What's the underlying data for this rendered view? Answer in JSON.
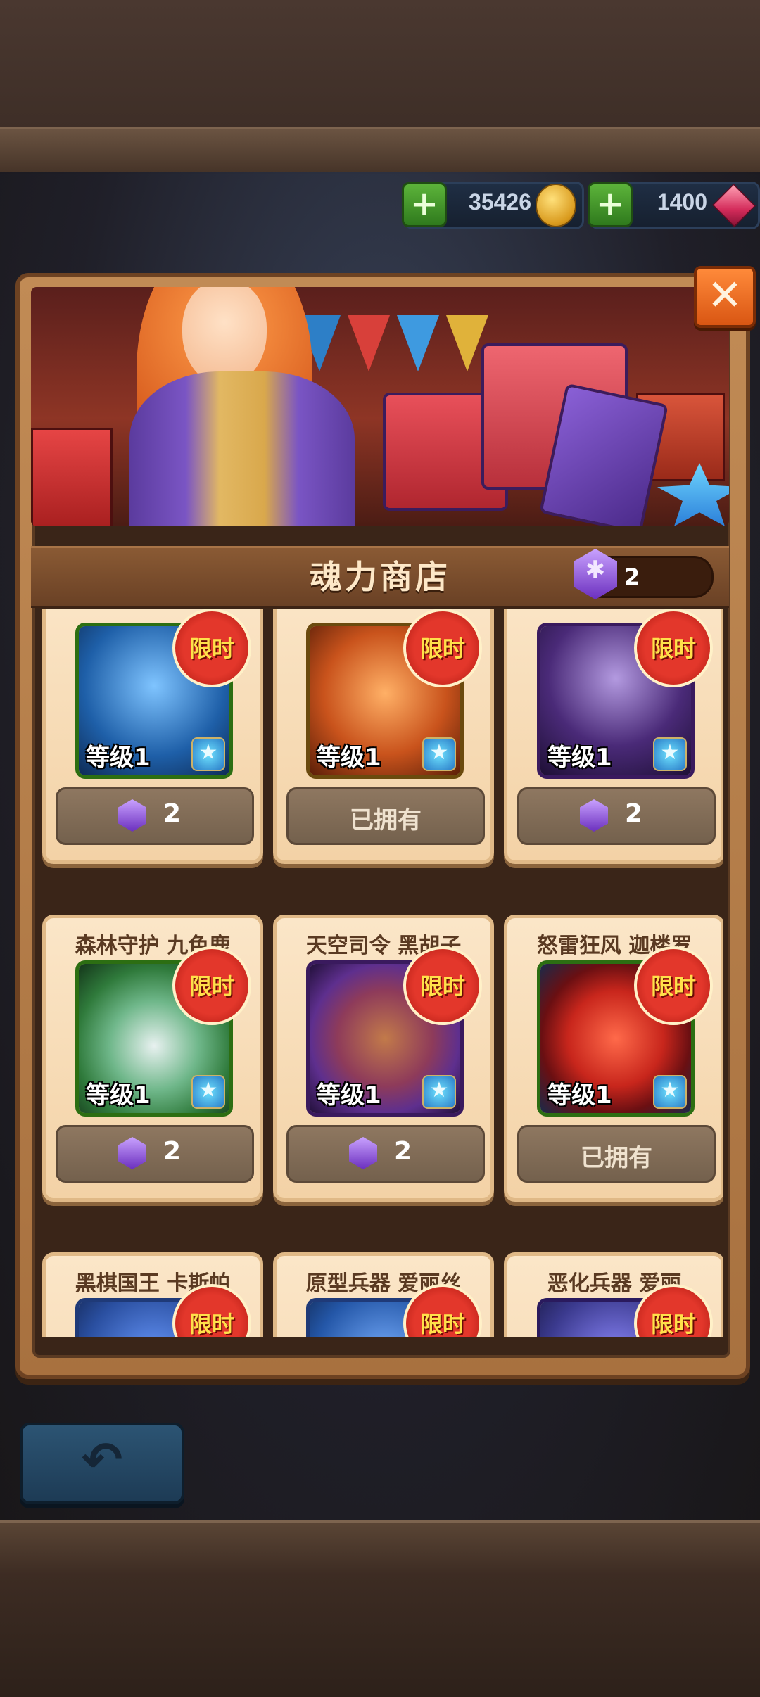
{
  "currencies": [
    {
      "id": "gold",
      "value": "35426",
      "icon": "gold-coin-icon"
    },
    {
      "id": "gems",
      "value": "1400",
      "icon": "red-gem-icon"
    }
  ],
  "shop": {
    "title": "魂力商店",
    "soul_power": "2",
    "close_icon": "close-icon",
    "back_icon": "back-arrow-icon"
  },
  "items": [
    {
      "name": "",
      "level": "等级1",
      "badge": "限时",
      "price": "2",
      "owned": false,
      "color": "#1e5fa8"
    },
    {
      "name": "",
      "level": "等级1",
      "badge": "限时",
      "price": "",
      "owned": true,
      "owned_label": "已拥有",
      "color": "#c9531c"
    },
    {
      "name": "",
      "level": "等级1",
      "badge": "限时",
      "price": "2",
      "owned": false,
      "color": "#4a2a78"
    },
    {
      "name": "森林守护 九色鹿",
      "level": "等级1",
      "badge": "限时",
      "price": "2",
      "owned": false,
      "color": "#2f7a3b"
    },
    {
      "name": "天空司令 黑胡子",
      "level": "等级1",
      "badge": "限时",
      "price": "2",
      "owned": false,
      "color": "#5e2f8e"
    },
    {
      "name": "怒雷狂风 迦楼罗",
      "level": "等级1",
      "badge": "限时",
      "price": "",
      "owned": true,
      "owned_label": "已拥有",
      "color": "#9a1e1c"
    },
    {
      "name": "黑棋国王 卡斯帕",
      "level": "",
      "badge": "限时",
      "price": "",
      "owned": false,
      "color": "#2a4fa0"
    },
    {
      "name": "原型兵器 爱丽丝",
      "level": "",
      "badge": "限时",
      "price": "",
      "owned": false,
      "color": "#2457a8"
    },
    {
      "name": "恶化兵器 爱丽",
      "level": "",
      "badge": "限时",
      "price": "",
      "owned": false,
      "color": "#3b3a8e"
    }
  ]
}
